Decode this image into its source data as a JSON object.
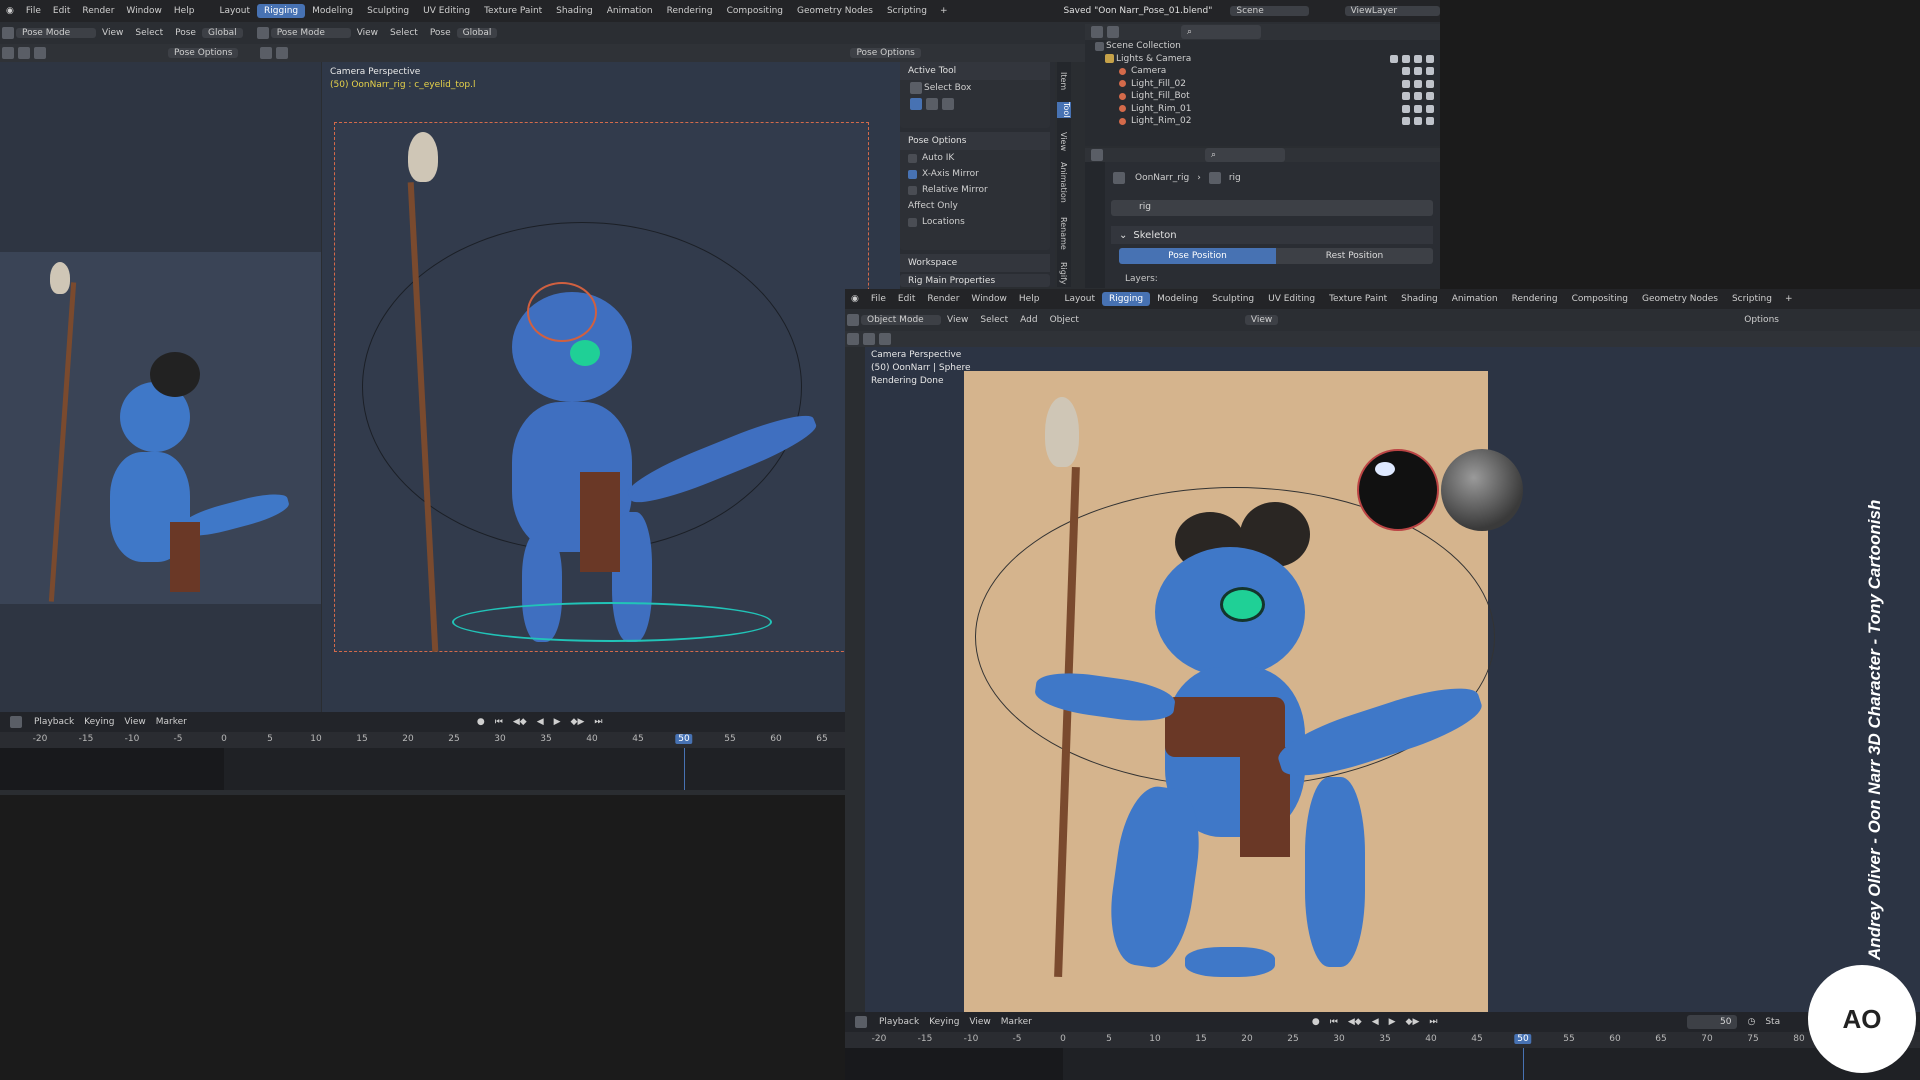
{
  "left_window": {
    "menu": [
      "File",
      "Edit",
      "Render",
      "Window",
      "Help"
    ],
    "workspaces": [
      "Layout",
      "Rigging",
      "Modeling",
      "Sculpting",
      "UV Editing",
      "Texture Paint",
      "Shading",
      "Animation",
      "Rendering",
      "Compositing",
      "Geometry Nodes",
      "Scripting"
    ],
    "active_workspace": "Rigging",
    "saved_message": "Saved \"Oon Narr_Pose_01.blend\"",
    "scene": "Scene",
    "view_layer": "ViewLayer",
    "toolbar_left": {
      "mode": "Pose Mode",
      "items": [
        "View",
        "Select",
        "Pose"
      ],
      "orientation": "Global"
    },
    "toolbar_right": {
      "mode": "Pose Mode",
      "items": [
        "View",
        "Select",
        "Pose"
      ],
      "orientation": "Global"
    },
    "pose_options": "Pose Options",
    "viewport": {
      "title": "Camera Perspective",
      "subtitle": "(50) OonNarr_rig : c_eyelid_top.l"
    },
    "tool_panel": {
      "active_tool_header": "Active Tool",
      "select_box": "Select Box",
      "pose_options_header": "Pose Options",
      "auto_ik": "Auto IK",
      "x_axis_mirror": "X-Axis Mirror",
      "relative_mirror": "Relative Mirror",
      "affect_only": "Affect Only",
      "locations": "Locations",
      "workspace_header": "Workspace",
      "rig_main": "Rig Main Properties",
      "side_tabs": [
        "Item",
        "Tool",
        "View",
        "Animation",
        "Rename",
        "Rigify"
      ]
    },
    "outliner": {
      "root": "Scene Collection",
      "collection": "Lights & Camera",
      "items": [
        "Camera",
        "Light_Fill_02",
        "Light_Fill_Bot",
        "Light_Rim_01",
        "Light_Rim_02"
      ]
    },
    "properties": {
      "object": "OonNarr_rig",
      "data": "rig",
      "name_field": "rig",
      "skeleton_header": "Skeleton",
      "pose_position": "Pose Position",
      "rest_position": "Rest Position",
      "layers": "Layers:"
    },
    "timeline": {
      "menus": [
        "Playback",
        "Keying",
        "View",
        "Marker"
      ],
      "ticks": [
        "-20",
        "-15",
        "-10",
        "-5",
        "0",
        "5",
        "10",
        "15",
        "20",
        "25",
        "30",
        "35",
        "40",
        "45",
        "50",
        "55",
        "60",
        "65"
      ],
      "current": "50"
    }
  },
  "right_window": {
    "menu": [
      "File",
      "Edit",
      "Render",
      "Window",
      "Help"
    ],
    "workspaces": [
      "Layout",
      "Rigging",
      "Modeling",
      "Sculpting",
      "UV Editing",
      "Texture Paint",
      "Shading",
      "Animation",
      "Rendering",
      "Compositing",
      "Geometry Nodes",
      "Scripting"
    ],
    "active_workspace": "Rigging",
    "toolbar": {
      "mode": "Object Mode",
      "items": [
        "View",
        "Select",
        "Add",
        "Object"
      ],
      "view": "View",
      "options": "Options"
    },
    "viewport": {
      "title": "Camera Perspective",
      "subtitle": "(50) OonNarr | Sphere",
      "status": "Rendering Done"
    },
    "timeline": {
      "menus": [
        "Playback",
        "Keying",
        "View",
        "Marker"
      ],
      "ticks": [
        "-20",
        "-15",
        "-10",
        "-5",
        "0",
        "5",
        "10",
        "15",
        "20",
        "25",
        "30",
        "35",
        "40",
        "45",
        "50",
        "55",
        "60",
        "65",
        "70",
        "75",
        "80"
      ],
      "current": "50",
      "frame_field": "50",
      "start_label": "Sta"
    }
  },
  "credit": "Andrey Oliver - Oon Narr 3D Character - Tony Cartoonish",
  "logo": "AO",
  "colors": {
    "accent": "#4772b3",
    "render_bg": "#d5b48d",
    "character": "#3f78c8"
  }
}
